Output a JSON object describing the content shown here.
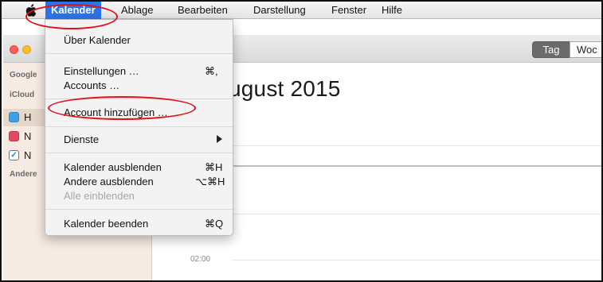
{
  "menubar": {
    "items": [
      "Kalender",
      "Ablage",
      "Bearbeiten",
      "Darstellung",
      "Fenster",
      "Hilfe"
    ]
  },
  "toolbar": {
    "view_day": "Tag",
    "view_week_partial": "Woc"
  },
  "sidebar": {
    "groups": [
      "Google",
      "iCloud",
      "Andere"
    ],
    "rows": [
      {
        "label": "H",
        "color": "#3ea0e6"
      },
      {
        "label": "N",
        "color": "#e8485f"
      },
      {
        "label": "N",
        "color": "#3ea0e6",
        "checked": true
      }
    ]
  },
  "main": {
    "month_title": "ugust 2015",
    "time_label": "02:00"
  },
  "menu": {
    "items": [
      {
        "label": "Über Kalender",
        "shortcut": ""
      },
      {
        "label": "Einstellungen …",
        "shortcut": "⌘,"
      },
      {
        "label": "Accounts …",
        "shortcut": ""
      },
      {
        "label": "Account hinzufügen …",
        "shortcut": ""
      },
      {
        "label": "Dienste",
        "shortcut": ""
      },
      {
        "label": "Kalender ausblenden",
        "shortcut": "⌘H"
      },
      {
        "label": "Andere ausblenden",
        "shortcut": "⌥⌘H"
      },
      {
        "label": "Alle einblenden",
        "shortcut": "",
        "disabled": true
      },
      {
        "label": "Kalender beenden",
        "shortcut": "⌘Q"
      }
    ]
  },
  "annotation_color": "#e2101a"
}
